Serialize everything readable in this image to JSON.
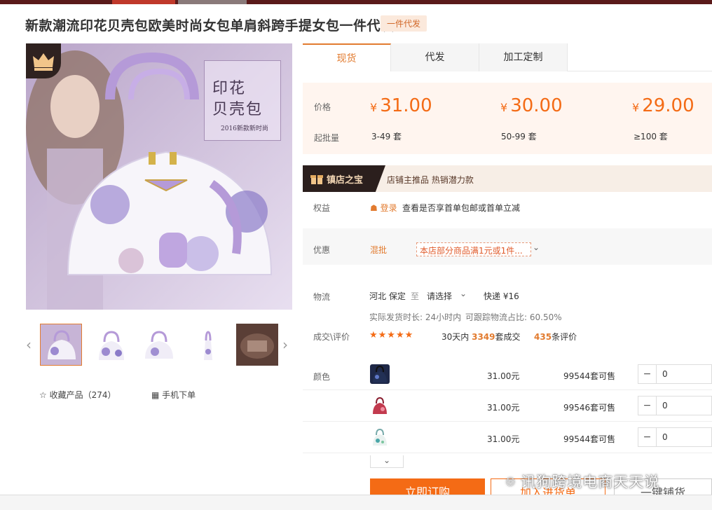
{
  "product": {
    "title": "新款潮流印花贝壳包欧美时尚女包单肩斜跨手提女包一件代发",
    "tag": "一件代发"
  },
  "image": {
    "caption_line1": "印花",
    "caption_line2": "贝壳包",
    "caption_small": "2016新款新时尚",
    "thumb_count": 5,
    "active_thumb": 1
  },
  "actions": {
    "favorite_label": "收藏产品（274）",
    "mobile_label": "手机下单"
  },
  "tabs": [
    {
      "label": "现货"
    },
    {
      "label": "代发"
    },
    {
      "label": "加工定制"
    }
  ],
  "pricing": {
    "price_label": "价格",
    "moq_label": "起批量",
    "currency": "¥",
    "tiers": [
      {
        "price": "31.00",
        "range": "3-49 套"
      },
      {
        "price": "30.00",
        "range": "50-99 套"
      },
      {
        "price": "29.00",
        "range": "≥100 套"
      }
    ]
  },
  "banner": {
    "title": "镇店之宝",
    "text": "店铺主推品  热销潜力款"
  },
  "rights": {
    "label": "权益",
    "login": "登录",
    "text": "查看是否享首单包邮或首单立减"
  },
  "discount": {
    "label": "优惠",
    "mix": "混批",
    "text": "本店部分商品满1元或1件..."
  },
  "logistics": {
    "label": "物流",
    "origin": "河北 保定",
    "to": "至",
    "dest": "请选择",
    "express": "快递 ¥16",
    "ship_time": "实际发货时长: 24小时内",
    "track": "可跟踪物流占比: 60.50%"
  },
  "reviews": {
    "label": "成交\\评价",
    "stars": "★★★★★",
    "deals_prefix": "30天内",
    "deals_count": "3349",
    "deals_suffix": "套成交",
    "review_count": "435",
    "review_suffix": "条评价"
  },
  "colors": {
    "label": "颜色",
    "rows": [
      {
        "price": "31.00元",
        "stock": "99544套可售",
        "qty": "0"
      },
      {
        "price": "31.00元",
        "stock": "99546套可售",
        "qty": "0"
      },
      {
        "price": "31.00元",
        "stock": "99544套可售",
        "qty": "0"
      }
    ]
  },
  "buttons": {
    "buy": "立即订购",
    "cart": "加入进货单",
    "dist": "一键铺货"
  },
  "watermark": "讯狗跨境电商天天说"
}
